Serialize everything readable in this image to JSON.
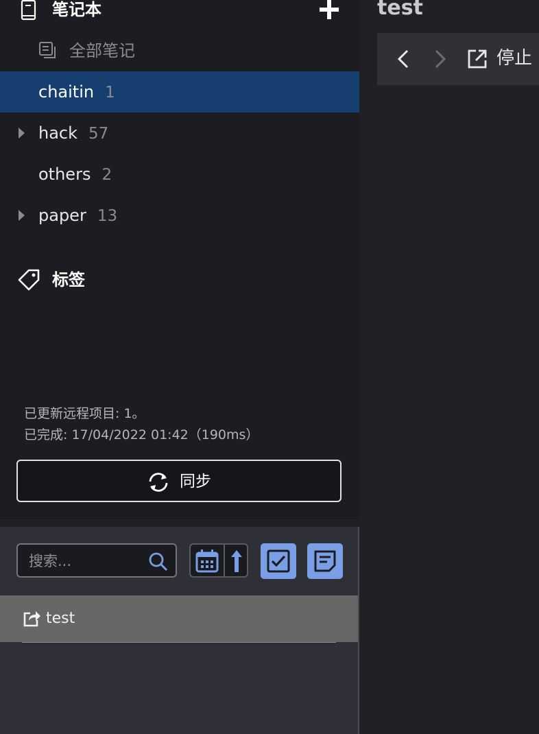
{
  "sidebar": {
    "notebooks_header": {
      "title": "笔记本",
      "icon": "book-icon",
      "add_icon": "plus-icon"
    },
    "all_notes": {
      "label": "全部笔记",
      "icon": "notes-stack-icon"
    },
    "notebooks": [
      {
        "name": "chaitin",
        "count": "1",
        "selected": true,
        "expandable": false
      },
      {
        "name": "hack",
        "count": "57",
        "selected": false,
        "expandable": true
      },
      {
        "name": "others",
        "count": "2",
        "selected": false,
        "expandable": false
      },
      {
        "name": "paper",
        "count": "13",
        "selected": false,
        "expandable": true
      }
    ],
    "tags": {
      "label": "标签",
      "icon": "tag-icon"
    },
    "status": {
      "line1": "已更新远程项目: 1。",
      "line2": "已完成: 17/04/2022 01:42（190ms）"
    },
    "sync_button": {
      "label": "同步",
      "icon": "sync-icon"
    }
  },
  "note_list": {
    "search": {
      "placeholder": "搜索...",
      "value": "",
      "icon": "search-icon"
    },
    "sort": {
      "field_icon": "calendar-icon",
      "order_icon": "arrow-up-icon"
    },
    "toggles": [
      {
        "icon": "checkbox-icon",
        "active": true
      },
      {
        "icon": "note-icon",
        "active": true
      }
    ],
    "notes": [
      {
        "title": "test",
        "icon": "share-icon",
        "selected": true
      }
    ]
  },
  "editor": {
    "title": "test",
    "toolbar": {
      "back_icon": "chevron-left-icon",
      "forward_icon": "chevron-right-icon",
      "external_icon": "external-link-icon",
      "stop_label": "停止"
    }
  },
  "colors": {
    "sidebar_bg": "#1c1d22",
    "selected_bg": "#163e6f",
    "accent": "#7a9ee6",
    "note_row_bg": "#676767"
  }
}
